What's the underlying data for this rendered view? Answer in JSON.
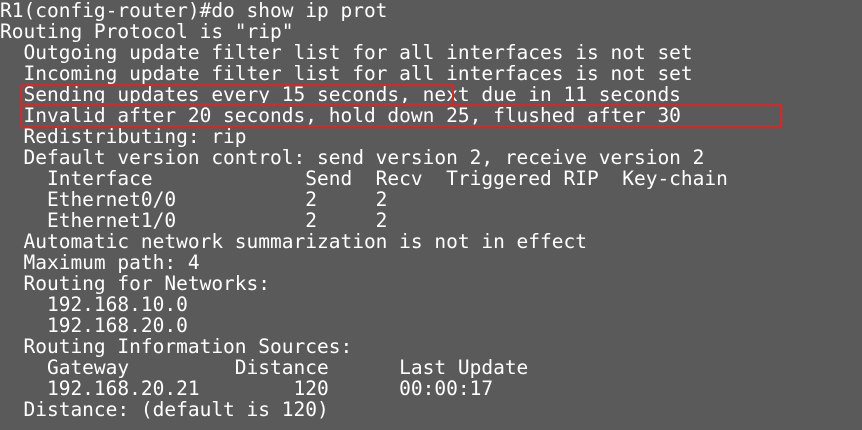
{
  "terminal": {
    "background": "#5a5a5a",
    "foreground": "#ffffff",
    "highlight_color": "#e02424",
    "lines": [
      "R1(config-router)#do show ip prot",
      "Routing Protocol is \"rip\"",
      "  Outgoing update filter list for all interfaces is not set",
      "  Incoming update filter list for all interfaces is not set",
      "  Sending updates every 15 seconds, next due in 11 seconds",
      "  Invalid after 20 seconds, hold down 25, flushed after 30",
      "  Redistributing: rip",
      "  Default version control: send version 2, receive version 2",
      "    Interface             Send  Recv  Triggered RIP  Key-chain",
      "    Ethernet0/0           2     2",
      "    Ethernet1/0           2     2",
      "  Automatic network summarization is not in effect",
      "  Maximum path: 4",
      "  Routing for Networks:",
      "    192.168.10.0",
      "    192.168.20.0",
      "  Routing Information Sources:",
      "    Gateway         Distance      Last Update",
      "    192.168.20.21        120      00:00:17",
      "  Distance: (default is 120)"
    ]
  }
}
